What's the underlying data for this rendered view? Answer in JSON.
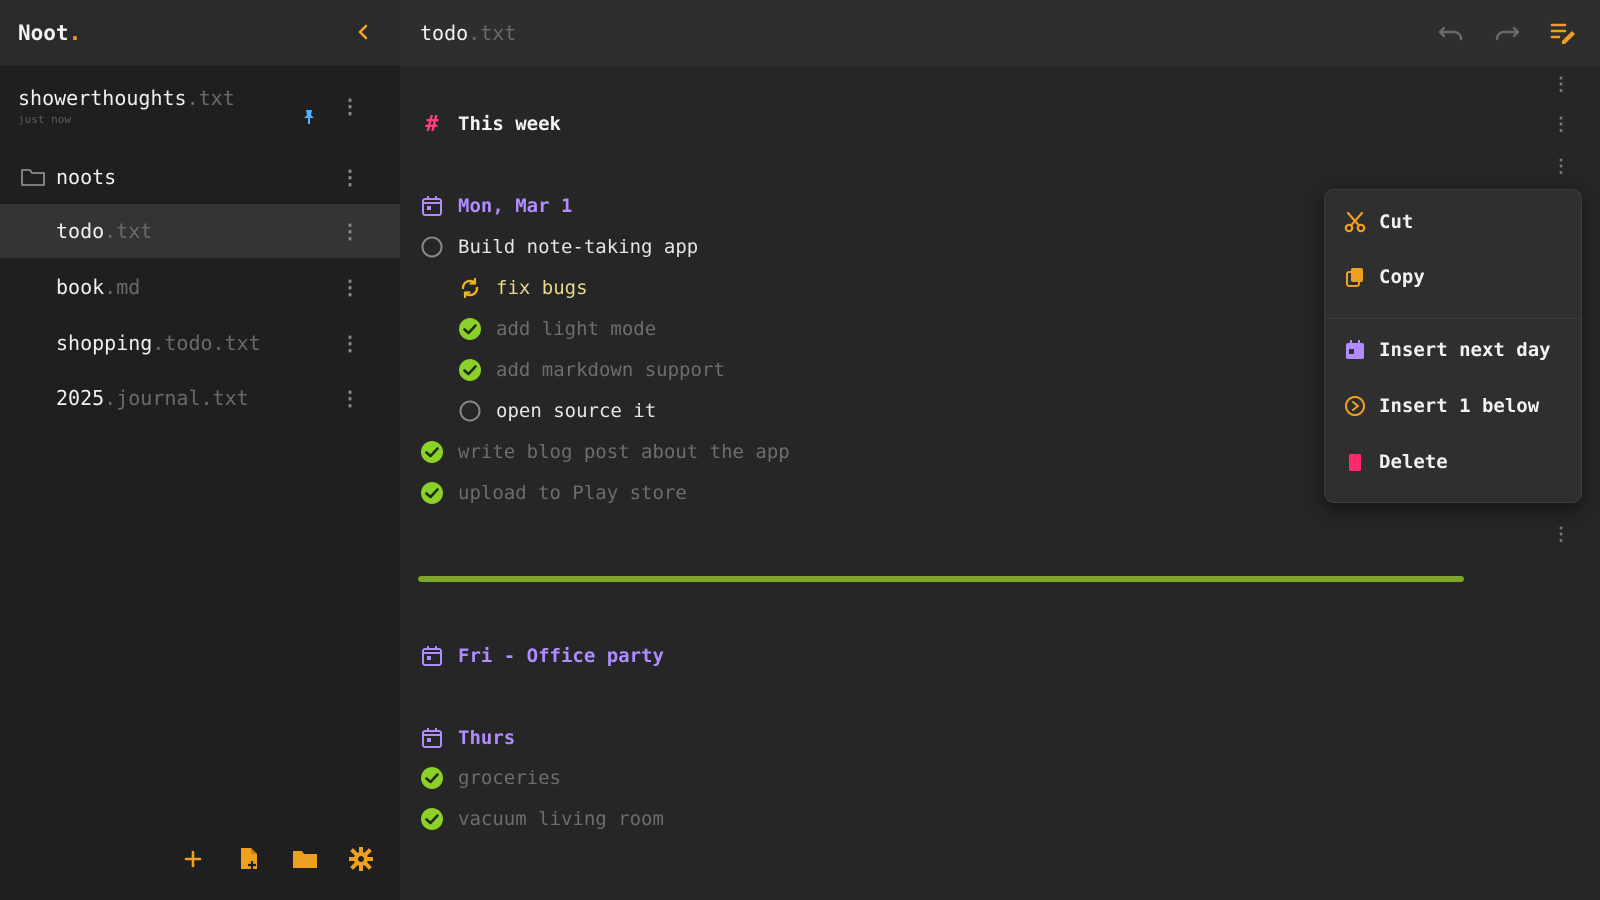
{
  "app": {
    "brand": "Noot",
    "brand_dot": "."
  },
  "sidebar": {
    "pinned": {
      "name": "showerthoughts",
      "ext": ".txt",
      "subtitle": "just now"
    },
    "folder": {
      "name": "noots"
    },
    "files": [
      {
        "name": "todo",
        "ext": ".txt"
      },
      {
        "name": "book",
        "ext": ".md"
      },
      {
        "name": "shopping",
        "ext": ".todo.txt"
      },
      {
        "name": "2025",
        "ext": ".journal.txt"
      }
    ]
  },
  "document": {
    "name": "todo",
    "ext": ".txt"
  },
  "editor": {
    "heading": "This week",
    "date1": "Mon, Mar 1",
    "task_main": "Build note-taking app",
    "task_fix": "fix bugs",
    "task_light": "add light mode",
    "task_markdown": "add markdown support",
    "task_opensource": "open source it",
    "task_blog": "write blog post about the app",
    "task_upload": "upload to Play store",
    "date2": "Fri - Office party",
    "date3": "Thurs",
    "task_groceries": "groceries",
    "task_vacuum": "vacuum living room"
  },
  "menu": {
    "cut": "Cut",
    "copy": "Copy",
    "insert_next_day": "Insert next day",
    "insert_below": "Insert 1 below",
    "delete": "Delete"
  },
  "colors": {
    "accent": "#f0a020",
    "date": "#b08cff",
    "done": "#8bd12a",
    "hash": "#ff3f78",
    "pin": "#4fb3ff",
    "delete": "#ff2a6d"
  }
}
